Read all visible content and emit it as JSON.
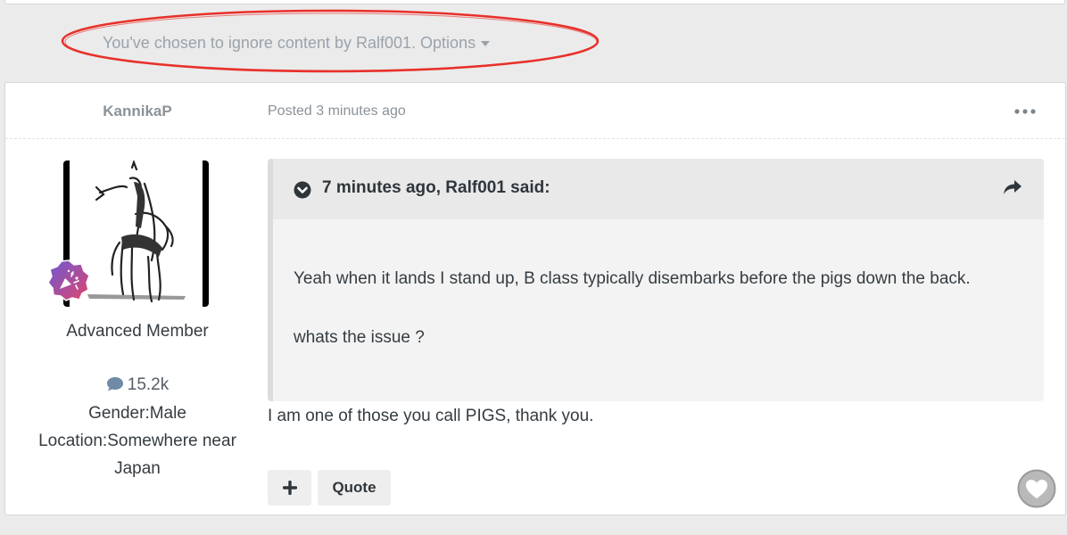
{
  "ignore_notice": {
    "text": "You've chosen to ignore content by Ralf001.",
    "options_label": "Options"
  },
  "post": {
    "author": "KannikaP",
    "posted": "Posted 3 minutes ago",
    "member_title": "Advanced Member",
    "post_count": "15.2k",
    "gender": "Gender:Male",
    "location_line1": "Location:Somewhere near",
    "location_line2": "Japan",
    "quote": {
      "cite": "7 minutes ago, Ralf001 said:",
      "paragraph1": "Yeah when it lands I stand up, B class typically disembarks before the pigs down the back.",
      "paragraph2": "whats the issue ?"
    },
    "body": "I am one of those you call PIGS, thank you.",
    "buttons": {
      "plus": "+",
      "quote": "Quote"
    }
  },
  "colors": {
    "annotation_ellipse": "#e8302a",
    "badge_start": "#6a5ad6",
    "badge_end": "#e1446a"
  },
  "icons": [
    "caret-down-icon",
    "more-menu-icon",
    "rank-badge-icon",
    "speech-bubble-icon",
    "chevron-circle-down-icon",
    "share-arrow-icon",
    "plus-icon",
    "heart-icon"
  ]
}
